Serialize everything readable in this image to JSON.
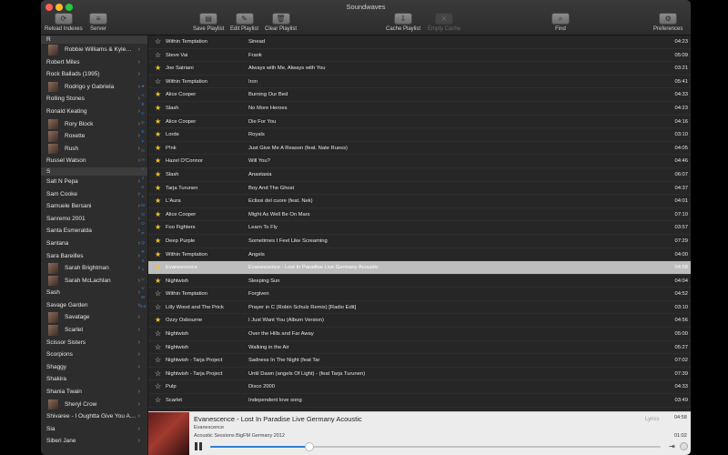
{
  "window_title": "Soundwaves",
  "toolbar": {
    "reload_label": "Reload Indexes",
    "server_label": "Server",
    "save_playlist_label": "Save Playlist",
    "edit_playlist_label": "Edit Playlist",
    "clear_playlist_label": "Clear Playlist",
    "cache_playlist_label": "Cache Playlist",
    "empty_cache_label": "Empty Cache",
    "find_label": "Find",
    "preferences_label": "Preferences"
  },
  "sidebar": {
    "rows": [
      {
        "label": "R",
        "kind": "header"
      },
      {
        "label": "Robbie Williams & Kyle…",
        "kind": "album"
      },
      {
        "label": "Robert Miles",
        "kind": "artist"
      },
      {
        "label": "Rock Ballads (1995)",
        "kind": "artist"
      },
      {
        "label": "Rodrigo y Gabriela",
        "kind": "album"
      },
      {
        "label": "Rolling Stones",
        "kind": "artist"
      },
      {
        "label": "Ronald Keating",
        "kind": "artist"
      },
      {
        "label": "Rory Block",
        "kind": "album"
      },
      {
        "label": "Roxette",
        "kind": "album"
      },
      {
        "label": "Rush",
        "kind": "album"
      },
      {
        "label": "Russel Watson",
        "kind": "artist"
      },
      {
        "label": "S",
        "kind": "header"
      },
      {
        "label": "Salt N Pepa",
        "kind": "artist"
      },
      {
        "label": "Sam Cooke",
        "kind": "artist"
      },
      {
        "label": "Samuele Bersani",
        "kind": "artist"
      },
      {
        "label": "Sanremo 2001",
        "kind": "artist"
      },
      {
        "label": "Santa Esmeralda",
        "kind": "artist"
      },
      {
        "label": "Santana",
        "kind": "artist"
      },
      {
        "label": "Sara Bareilles",
        "kind": "artist"
      },
      {
        "label": "Sarah Brightman",
        "kind": "album"
      },
      {
        "label": "Sarah McLachlan",
        "kind": "album"
      },
      {
        "label": "Sash",
        "kind": "artist"
      },
      {
        "label": "Savage Garden",
        "kind": "artist"
      },
      {
        "label": "Savatage",
        "kind": "album"
      },
      {
        "label": "Scarlet",
        "kind": "album"
      },
      {
        "label": "Scissor Sisters",
        "kind": "artist"
      },
      {
        "label": "Scorpions",
        "kind": "artist"
      },
      {
        "label": "Shaggy",
        "kind": "artist"
      },
      {
        "label": "Shakira",
        "kind": "artist"
      },
      {
        "label": "Shania Twain",
        "kind": "artist"
      },
      {
        "label": "Sheryl Crow",
        "kind": "album"
      },
      {
        "label": "Shivaree - I Oughtta Give You A…",
        "kind": "artist"
      },
      {
        "label": "Sia",
        "kind": "artist"
      },
      {
        "label": "Siberi Jane",
        "kind": "artist"
      }
    ],
    "index_letters": [
      "★",
      "A",
      "B",
      "C",
      "D",
      "E",
      "F",
      "G",
      "H",
      "I",
      "J",
      "K",
      "L",
      "M",
      "N",
      "O",
      "P",
      "Q",
      "R",
      "S",
      "T",
      "U",
      "V",
      "W",
      "X-Z"
    ]
  },
  "tracks": [
    {
      "fav": false,
      "artist": "Within Temptation",
      "title": "Sinead",
      "duration": "04:23"
    },
    {
      "fav": false,
      "artist": "Steve Vai",
      "title": "Frank",
      "duration": "05:09"
    },
    {
      "fav": true,
      "artist": "Joe Satriani",
      "title": "Always with Me, Always with You",
      "duration": "03:21"
    },
    {
      "fav": false,
      "artist": "Within Temptation",
      "title": "Iron",
      "duration": "05:41"
    },
    {
      "fav": true,
      "artist": "Alice Cooper",
      "title": "Burning Our Bed",
      "duration": "04:33"
    },
    {
      "fav": true,
      "artist": "Slash",
      "title": "No More Heroes",
      "duration": "04:23"
    },
    {
      "fav": true,
      "artist": "Alice Cooper",
      "title": "Die For You",
      "duration": "04:16"
    },
    {
      "fav": true,
      "artist": "Lorde",
      "title": "Royals",
      "duration": "03:10"
    },
    {
      "fav": true,
      "artist": "P!nk",
      "title": "Just Give Me A Reason (feat. Nate Ruess)",
      "duration": "04:05"
    },
    {
      "fav": true,
      "artist": "Hazel O'Connor",
      "title": "Will You?",
      "duration": "04:46"
    },
    {
      "fav": true,
      "artist": "Slash",
      "title": "Anastasia",
      "duration": "06:07"
    },
    {
      "fav": true,
      "artist": "Tarja Turunen",
      "title": "Boy And The Ghost",
      "duration": "04:37"
    },
    {
      "fav": true,
      "artist": "L'Aura",
      "title": "Eclissi del cuore (feat. Nek)",
      "duration": "04:01"
    },
    {
      "fav": true,
      "artist": "Alice Cooper",
      "title": "Might As Well Be On Mars",
      "duration": "07:10"
    },
    {
      "fav": true,
      "artist": "Foo Fighters",
      "title": "Learn To Fly",
      "duration": "03:57"
    },
    {
      "fav": true,
      "artist": "Deep Purple",
      "title": "Sometimes I Feel Like Screaming",
      "duration": "07:29"
    },
    {
      "fav": true,
      "artist": "Within Temptation",
      "title": "Angels",
      "duration": "04:00"
    },
    {
      "fav": true,
      "artist": "Evanescence",
      "title": "Evanescence - Lost In Paradise Live Germany Acoustic",
      "duration": "04:58",
      "selected": true
    },
    {
      "fav": true,
      "artist": "Nightwish",
      "title": "Sleeping Sun",
      "duration": "04:04"
    },
    {
      "fav": false,
      "artist": "Within Temptation",
      "title": "Forgiven",
      "duration": "04:52"
    },
    {
      "fav": false,
      "artist": "Lilly Wood and The Prick",
      "title": "Prayer in C (Robin Schulz Remix) [Radio Edit]",
      "duration": "03:10"
    },
    {
      "fav": true,
      "artist": "Ozzy Osbourne",
      "title": "I Just Want You (Album Version)",
      "duration": "04:56"
    },
    {
      "fav": false,
      "artist": "Nightwish",
      "title": "Over the Hills and Far Away",
      "duration": "05:00"
    },
    {
      "fav": false,
      "artist": "Nightwish",
      "title": "Walking in the Air",
      "duration": "05:27"
    },
    {
      "fav": false,
      "artist": "Nightwish - Tarja Project",
      "title": "Sadness In The Night (feat Tar",
      "duration": "07:02"
    },
    {
      "fav": false,
      "artist": "Nightwish - Tarja Project",
      "title": "Until Dawn (angels Of Light) - (feat Tarja Turunen)",
      "duration": "07:39"
    },
    {
      "fav": false,
      "artist": "Pulp",
      "title": "Disco 2000",
      "duration": "04:33"
    },
    {
      "fav": false,
      "artist": "Scarlet",
      "title": "Independent love song",
      "duration": "03:49"
    }
  ],
  "now_playing": {
    "title": "Evanescence - Lost In Paradise Live Germany Acoustic",
    "artist": "Evanescence",
    "album": "Acoustic Sessions BigFM Germany 2012",
    "lyrics_label": "Lyrics",
    "duration": "04:58",
    "elapsed": "01:02",
    "progress": 0.22
  },
  "colors": {
    "accent": "#2f7fd6",
    "favorite_star": "#f2c230",
    "selection": "#bdbdbd"
  }
}
